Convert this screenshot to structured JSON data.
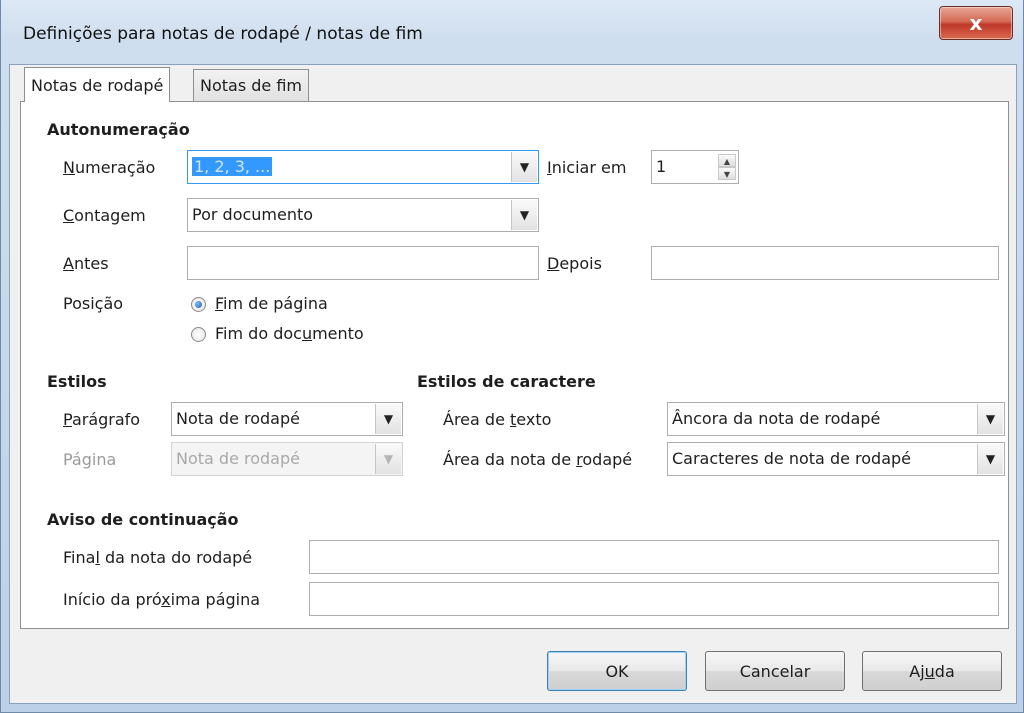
{
  "window": {
    "title": "Definições para notas de rodapé / notas de fim",
    "close_glyph": "x"
  },
  "tabs": [
    {
      "label": "Notas de rodapé"
    },
    {
      "label": "Notas de fim"
    }
  ],
  "autonumbering": {
    "heading": "Autonumeração",
    "numbering_label_u": "N",
    "numbering_label_rest": "umeração",
    "numbering_value": "1, 2, 3, ...",
    "start_label_u": "I",
    "start_label_rest": "niciar em",
    "start_value": "1",
    "counting_label_u": "C",
    "counting_label_rest": "ontagem",
    "counting_value": "Por documento",
    "before_label_u": "A",
    "before_label_rest": "ntes",
    "before_value": "",
    "after_label_u": "D",
    "after_label_rest": "epois",
    "after_value": "",
    "position_label": "Posição",
    "position_end_page_u": "F",
    "position_end_page_rest": "im de página",
    "position_end_doc_a": "Fim do doc",
    "position_end_doc_u": "u",
    "position_end_doc_b": "mento"
  },
  "styles": {
    "heading": "Estilos",
    "paragraph_label_u": "P",
    "paragraph_label_rest": "arágrafo",
    "paragraph_value": "Nota de rodapé",
    "page_label": "Página",
    "page_value": "Nota de rodapé"
  },
  "char_styles": {
    "heading": "Estilos de caractere",
    "text_area_a": "Área de ",
    "text_area_u": "t",
    "text_area_b": "exto",
    "text_area_value": "Âncora da nota de rodapé",
    "footnote_area_a": "Área da nota de ",
    "footnote_area_u": "r",
    "footnote_area_b": "odapé",
    "footnote_area_value": "Caracteres de nota de rodapé"
  },
  "continuation": {
    "heading": "Aviso de continuação",
    "end_a": "Fina",
    "end_u": "l",
    "end_b": " da nota do rodapé",
    "end_value": "",
    "next_a": "Início da pró",
    "next_u": "x",
    "next_b": "ima página",
    "next_value": ""
  },
  "buttons": {
    "ok": "OK",
    "cancel": "Cancelar",
    "help_a": "Aj",
    "help_u": "u",
    "help_b": "da"
  }
}
